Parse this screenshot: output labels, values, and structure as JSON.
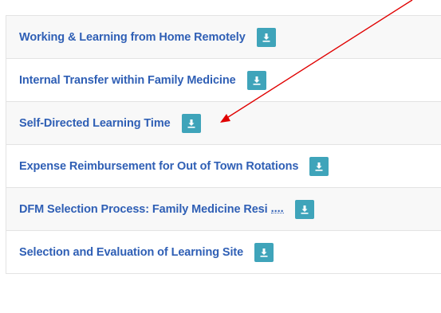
{
  "documents": [
    {
      "label": "Working & Learning from Home Remotely",
      "icon": "download-icon"
    },
    {
      "label": "Internal Transfer within Family Medicine",
      "icon": "download-icon"
    },
    {
      "label": "Self-Directed Learning Time",
      "icon": "download-icon"
    },
    {
      "label": "Expense Reimbursement for Out of Town Rotations",
      "icon": "download-icon"
    },
    {
      "label": "DFM Selection Process: Family Medicine Resi",
      "truncation": "....",
      "icon": "download-icon"
    },
    {
      "label": "Selection and Evaluation of Learning Site",
      "icon": "download-icon"
    }
  ],
  "colors": {
    "link": "#2f5fb5",
    "download_button": "#3fa4ba",
    "annotation_arrow": "#e00000"
  }
}
